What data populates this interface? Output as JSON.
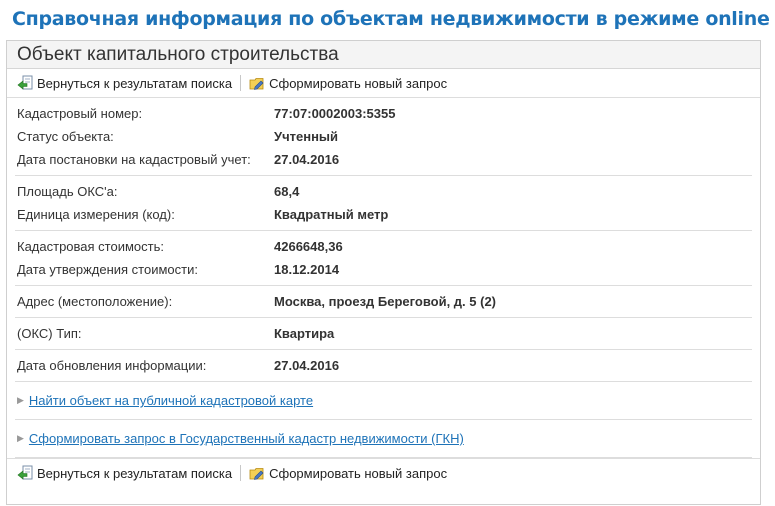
{
  "page": {
    "title": "Справочная информация по объектам недвижимости в режиме online"
  },
  "panel": {
    "header": "Объект капитального строительства"
  },
  "toolbar": {
    "back_label": "Вернуться к результатам поиска",
    "new_request_label": "Сформировать новый запрос"
  },
  "sections": [
    {
      "rows": [
        {
          "label": "Кадастровый номер:",
          "value": "77:07:0002003:5355"
        },
        {
          "label": "Статус объекта:",
          "value": "Учтенный"
        },
        {
          "label": "Дата постановки на кадастровый учет:",
          "value": "27.04.2016"
        }
      ]
    },
    {
      "rows": [
        {
          "label": "Площадь ОКС'а:",
          "value": "68,4"
        },
        {
          "label": "Единица измерения (код):",
          "value": "Квадратный метр"
        }
      ]
    },
    {
      "rows": [
        {
          "label": "Кадастровая стоимость:",
          "value": "4266648,36"
        },
        {
          "label": "Дата утверждения стоимости:",
          "value": "18.12.2014"
        }
      ]
    },
    {
      "rows": [
        {
          "label": "Адрес (местоположение):",
          "value": "Москва, проезд Береговой, д. 5 (2)"
        }
      ]
    },
    {
      "rows": [
        {
          "label": "(ОКС) Тип:",
          "value": "Квартира"
        }
      ]
    },
    {
      "rows": [
        {
          "label": "Дата обновления информации:",
          "value": "27.04.2016"
        }
      ]
    }
  ],
  "links": {
    "map_link": "Найти объект на публичной кадастровой карте",
    "gkn_link": "Сформировать запрос в Государственный кадастр недвижимости (ГКН)"
  },
  "colors": {
    "accent": "#1e73b8",
    "border": "#dddddd"
  },
  "icons": {
    "back": "back-arrow-icon",
    "new_request": "folder-pen-icon"
  }
}
